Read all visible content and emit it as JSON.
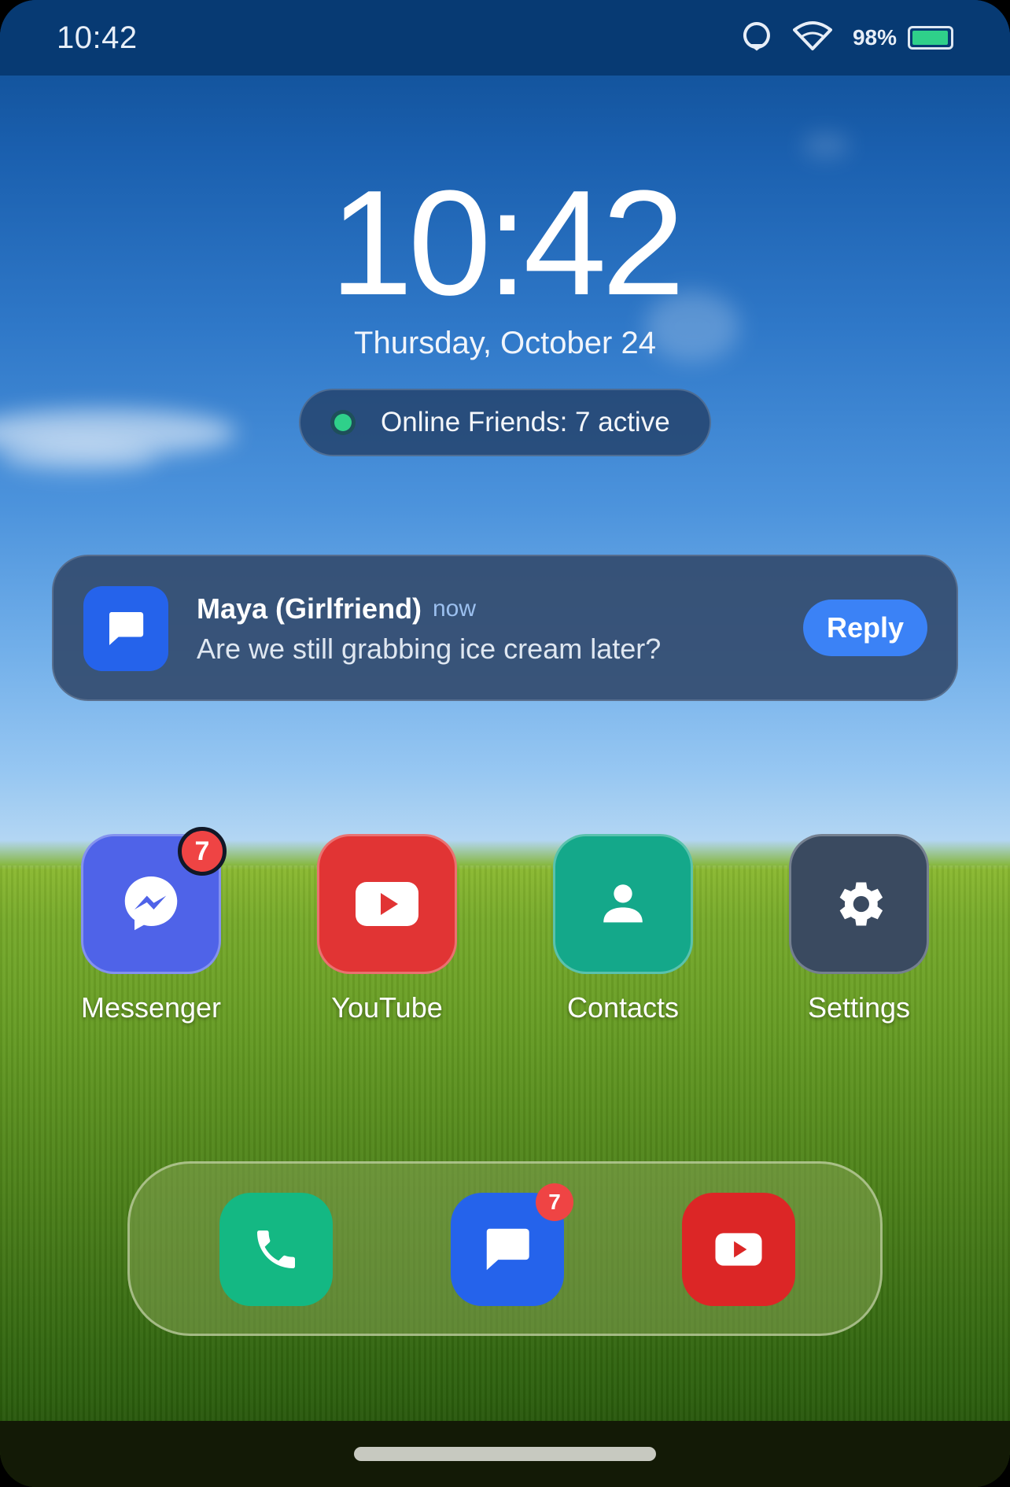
{
  "status_bar": {
    "time": "10:42",
    "battery_text": "98%",
    "battery_level": 0.98,
    "icons": [
      "circle-status-icon",
      "wifi-icon",
      "battery-icon"
    ]
  },
  "lock": {
    "clock": "10:42",
    "date": "Thursday, October 24"
  },
  "friends_pill": {
    "text": "Online Friends: 7 active",
    "dot_color": "#2fd08a"
  },
  "notification": {
    "icon": "chat-bubble-icon",
    "title": "Maya (Girlfriend)",
    "time": "now",
    "message": "Are we still grabbing ice cream later?",
    "reply_label": "Reply"
  },
  "apps": [
    {
      "label": "Messenger",
      "icon": "messenger-icon",
      "color": "#4f63e8",
      "badge": "7"
    },
    {
      "label": "YouTube",
      "icon": "youtube-play-icon",
      "color": "#e13434"
    },
    {
      "label": "Contacts",
      "icon": "person-icon",
      "color": "#14a88a"
    },
    {
      "label": "Settings",
      "icon": "gear-icon",
      "color": "#3a4a60"
    }
  ],
  "dock": [
    {
      "icon": "phone-icon",
      "color": "#14b883"
    },
    {
      "icon": "chat-bubble-icon",
      "color": "#2563eb",
      "badge": "7"
    },
    {
      "icon": "youtube-play-icon",
      "color": "#dc2626"
    }
  ]
}
